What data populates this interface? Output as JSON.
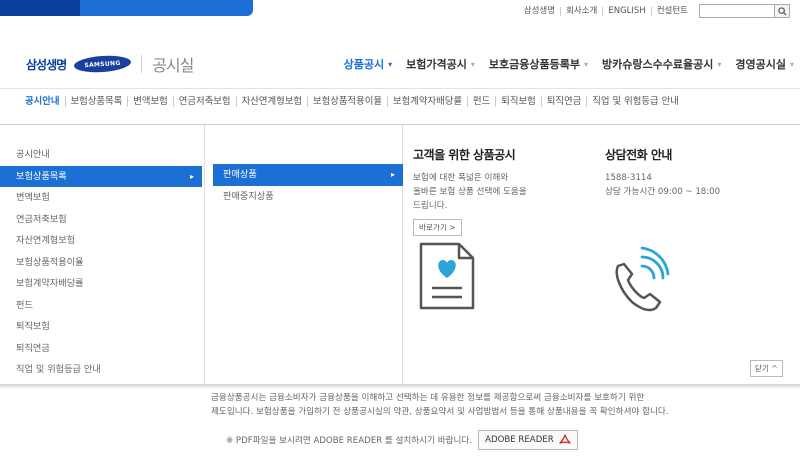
{
  "util": {
    "links": [
      "삼성생명",
      "회사소개",
      "ENGLISH",
      "컨설턴트"
    ],
    "search_placeholder": ""
  },
  "brand": {
    "company": "삼성생명",
    "samsung_logo": "SAMSUNG",
    "page_title": "공시실"
  },
  "gnb": {
    "items": [
      {
        "label": "상품공시"
      },
      {
        "label": "보험가격공시"
      },
      {
        "label": "보호금융상품등록부"
      },
      {
        "label": "방카슈랑스수수료율공시"
      },
      {
        "label": "경영공시실"
      }
    ],
    "caret": "▾",
    "active_color": "#1c6fd4"
  },
  "lnb": {
    "items": [
      "공시안내",
      "보험상품목록",
      "변액보험",
      "연금저축보험",
      "자산연계형보험",
      "보험상품적용이율",
      "보험계약자배당률",
      "펀드",
      "퇴직보험",
      "퇴직연금",
      "직업 및 위험등급 안내"
    ]
  },
  "mega": {
    "col1": [
      "공시안내",
      "보험상품목록",
      "변액보험",
      "연금저축보험",
      "자산연계형보험",
      "보험상품적용이율",
      "보험계약자배당률",
      "펀드",
      "퇴직보험",
      "퇴직연금",
      "직업 및 위험등급 안내"
    ],
    "col2": [
      "판매상품",
      "판매중지상품"
    ],
    "arrow": "▸",
    "panel1": {
      "title": "고객을 위한 상품공시",
      "desc_lines": [
        "보험에 대한 폭넓은 이해와",
        "올바른 보험 상품 선택에 도움을",
        "드립니다."
      ],
      "button": "바로가기 >",
      "icon": "document-heart-icon"
    },
    "panel2": {
      "title": "상담전화 안내",
      "phone": "1588-3114",
      "hours": "상담 가능시간 09:00 ~ 18:00",
      "icon": "phone-icon"
    },
    "close": "닫기 ^"
  },
  "notice": {
    "lines": [
      "금융상품공시는 금융소비자가 금융상품을 이해하고 선택하는 데 유용한 정보를 제공함으로써 금융소비자를 보호하기 위한",
      "제도입니다. 보험상품을 가입하기 전 상품공시실의 약관, 상품요약서 및 사업방법서 등을 통해 상품내용을 꼭 확인하셔야 합니다."
    ],
    "pdf_text": "※ PDF파일을 보시려면 ADOBE READER 를 설치하시기 바랍니다.",
    "adobe_button": "ADOBE READER"
  }
}
